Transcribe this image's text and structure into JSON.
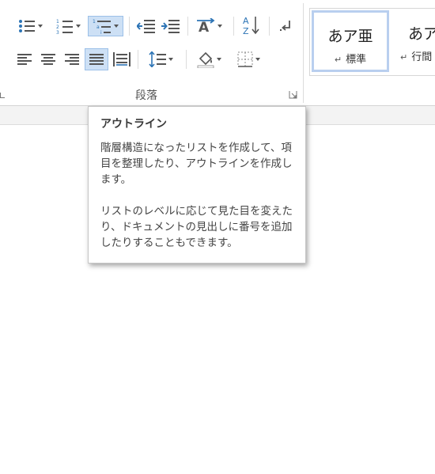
{
  "ribbon": {
    "paragraph_group": {
      "label": "段落",
      "buttons": [
        {
          "name": "bullets-button",
          "icon": "bullets-icon"
        },
        {
          "name": "numbering-button",
          "icon": "numbering-icon"
        },
        {
          "name": "multilevel-list-button",
          "icon": "multilevel-list-icon",
          "state": "hover"
        },
        {
          "name": "decrease-indent-button",
          "icon": "decrease-indent-icon"
        },
        {
          "name": "increase-indent-button",
          "icon": "increase-indent-icon"
        },
        {
          "name": "asian-layout-button",
          "icon": "asian-layout-icon"
        },
        {
          "name": "sort-button",
          "icon": "sort-icon"
        },
        {
          "name": "show-hide-marks-button",
          "icon": "paragraph-mark-icon"
        },
        {
          "name": "align-left-button",
          "icon": "align-left-icon"
        },
        {
          "name": "align-center-button",
          "icon": "align-center-icon"
        },
        {
          "name": "align-right-button",
          "icon": "align-right-icon"
        },
        {
          "name": "justify-button",
          "icon": "justify-icon",
          "state": "selected"
        },
        {
          "name": "distributed-button",
          "icon": "distributed-icon"
        },
        {
          "name": "line-spacing-button",
          "icon": "line-spacing-icon"
        },
        {
          "name": "shading-button",
          "icon": "paint-bucket-icon"
        },
        {
          "name": "borders-button",
          "icon": "borders-icon"
        }
      ]
    },
    "styles_group": {
      "items": [
        {
          "sample": "あア亜",
          "name": "標準",
          "return_mark": "↵",
          "active": true
        },
        {
          "sample": "あア",
          "name": "行間",
          "return_mark": "↵",
          "active": false
        }
      ]
    }
  },
  "tooltip": {
    "title": "アウトライン",
    "paragraph1": "階層構造になったリストを作成して、項目を整理したり、アウトラインを作成します。",
    "paragraph2": "リストのレベルに応じて見た目を変えたり、ドキュメントの見出しに番号を追加したりすることもできます。"
  },
  "colors": {
    "selected_bg": "#cde0f5",
    "selected_border": "#9cc0e8",
    "icon_blue": "#2e75b6",
    "text": "#444444"
  }
}
